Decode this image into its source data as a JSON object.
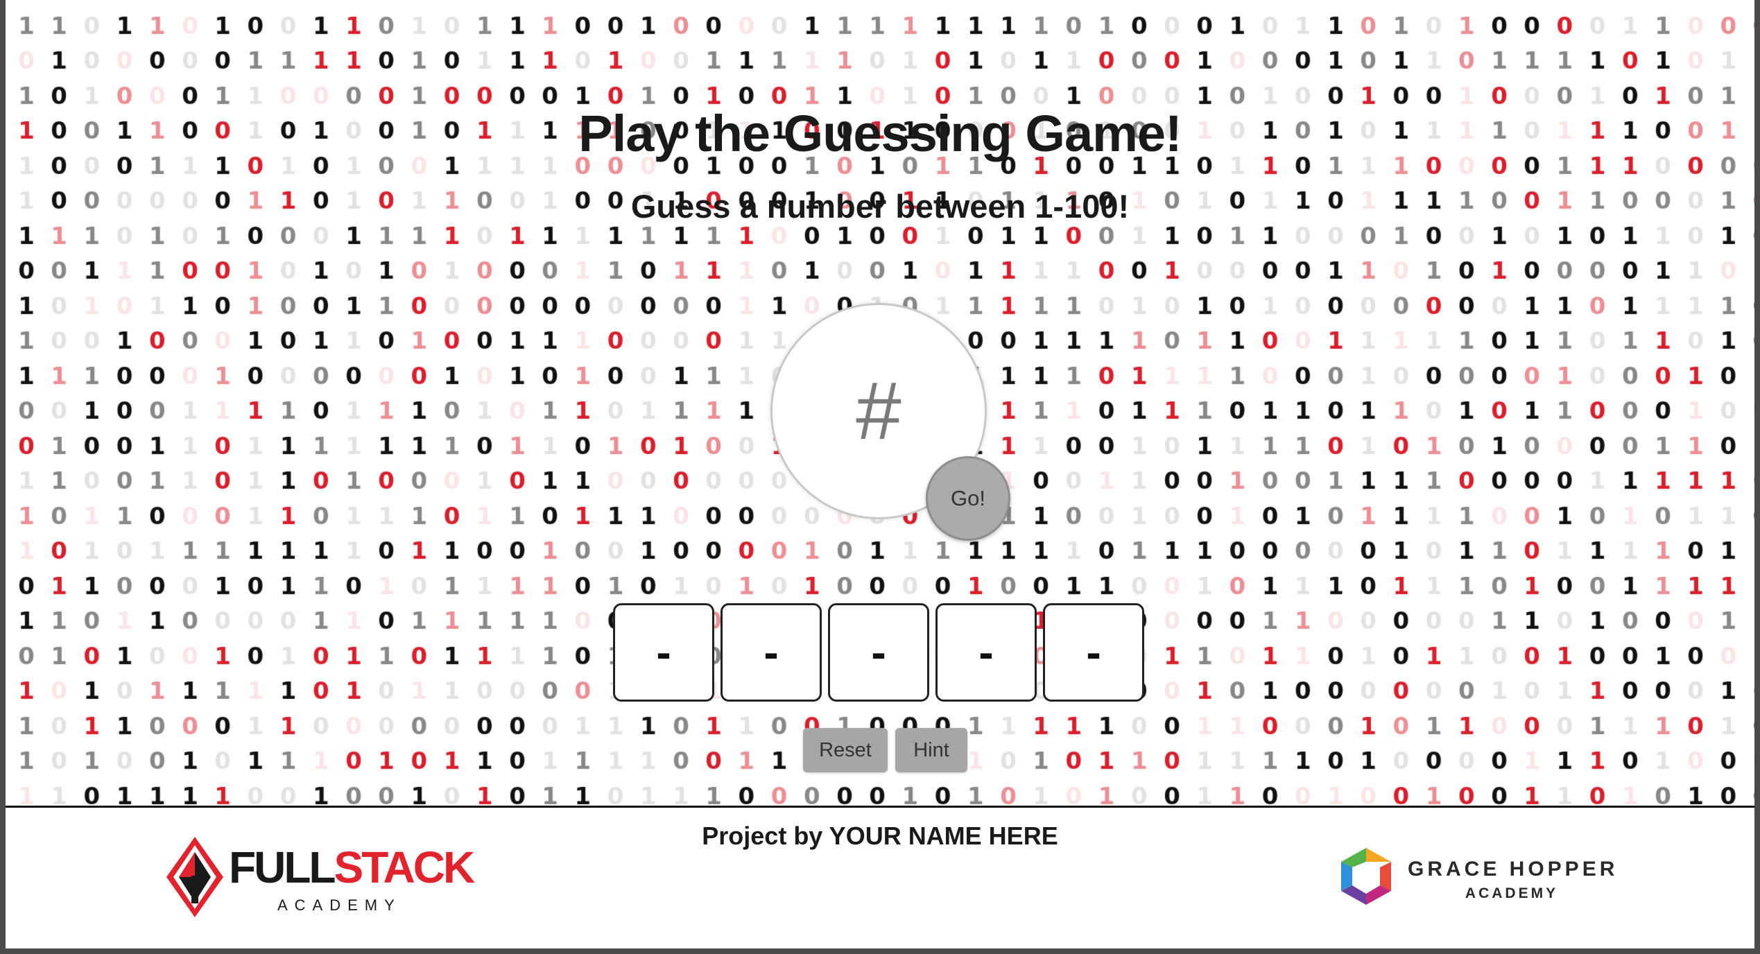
{
  "game": {
    "title": "Play the Guessing Game!",
    "subtitle": "Guess a number between 1-100!",
    "input_placeholder": "#",
    "go_label": "Go!",
    "previous_guesses": [
      "-",
      "-",
      "-",
      "-",
      "-"
    ],
    "reset_label": "Reset",
    "hint_label": "Hint"
  },
  "footer": {
    "credit": "Project by YOUR NAME HERE",
    "fullstack_logo": {
      "word_dark": "FULL",
      "word_red": "STACK",
      "sub": "ACADEMY"
    },
    "gracehopper_logo": {
      "title": "GRACE HOPPER",
      "sub": "ACADEMY"
    }
  },
  "background": {
    "digits": "0 1",
    "colors": [
      "#111111",
      "#d91f2c"
    ]
  },
  "colors": {
    "accent_red": "#e0232d",
    "button_gray": "#a6a6a6"
  }
}
